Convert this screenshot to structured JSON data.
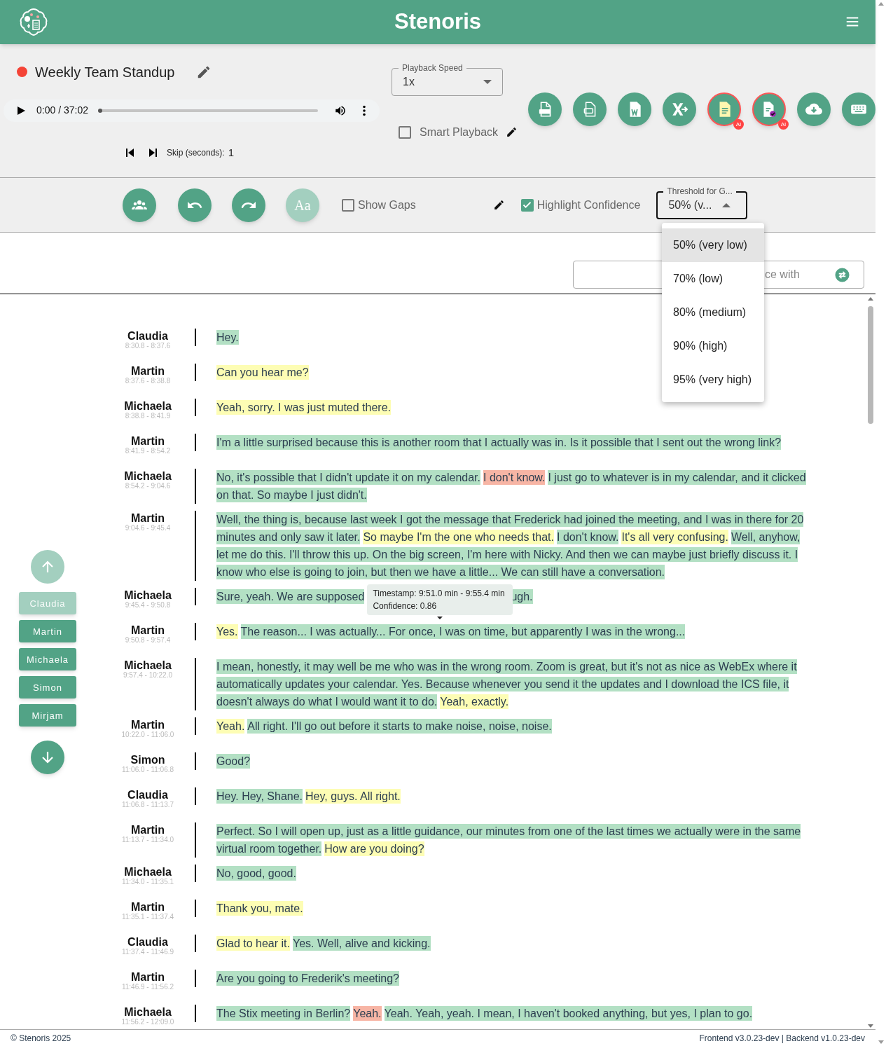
{
  "header": {
    "title": "Stenoris"
  },
  "recording": {
    "title": "Weekly Team Standup",
    "recording_dot": true
  },
  "player": {
    "time": "0:00 / 37:02",
    "level": 0.0
  },
  "skip": {
    "label": "Skip (seconds):",
    "value": "1"
  },
  "playback_speed": {
    "label": "Playback Speed",
    "value": "1x"
  },
  "smart_playback": {
    "label": "Smart Playback",
    "checked": false
  },
  "export_buttons": [
    {
      "kind": "txt",
      "ai": false
    },
    {
      "kind": "srt",
      "ai": false
    },
    {
      "kind": "word",
      "ai": false
    },
    {
      "kind": "excel",
      "ai": false
    },
    {
      "kind": "summary",
      "ai": true,
      "badge": "AI"
    },
    {
      "kind": "review",
      "ai": true,
      "badge": "AI"
    },
    {
      "kind": "cloud",
      "ai": false
    },
    {
      "kind": "keyboard",
      "ai": false
    }
  ],
  "toolbar": {
    "buttons": [
      {
        "kind": "speakers",
        "disabled": false
      },
      {
        "kind": "undo",
        "disabled": false
      },
      {
        "kind": "redo",
        "disabled": false
      },
      {
        "kind": "font",
        "disabled": true,
        "label": "Aa"
      }
    ],
    "show_gaps": {
      "label": "Show Gaps",
      "checked": false
    },
    "highlight_confidence": {
      "label": "Highlight Confidence",
      "checked": true
    },
    "threshold": {
      "label": "Threshold for G...",
      "value": "50% (v...",
      "expanded": true,
      "options": [
        {
          "label": "50% (very low)",
          "selected": true
        },
        {
          "label": "70% (low)",
          "selected": false
        },
        {
          "label": "80% (medium)",
          "selected": false
        },
        {
          "label": "90% (high)",
          "selected": false
        },
        {
          "label": "95% (very high)",
          "selected": false
        }
      ]
    }
  },
  "replace_field": {
    "placeholder": "ce with"
  },
  "speaker_nav": [
    {
      "label": "Claudia",
      "disabled": true
    },
    {
      "label": "Martin",
      "disabled": false
    },
    {
      "label": "Michaela",
      "disabled": false
    },
    {
      "label": "Simon",
      "disabled": false
    },
    {
      "label": "Mirjam",
      "disabled": false
    }
  ],
  "transcript": [
    {
      "speaker": "Claudia",
      "time": "8:30.8 - 8:37.6",
      "lines": [
        [
          {
            "text": "Hey.",
            "color": "#b3e0c4"
          }
        ]
      ]
    },
    {
      "speaker": "Martin",
      "time": "8:37.6 - 8:38.8",
      "lines": [
        [
          {
            "text": "Can you hear me?",
            "color": "#fdfdb4"
          }
        ]
      ]
    },
    {
      "speaker": "Michaela",
      "time": "8:38.8 - 8:41.9",
      "lines": [
        [
          {
            "text": "Yeah, sorry. I was just muted there.",
            "color": "#fdfdb4"
          }
        ]
      ]
    },
    {
      "speaker": "Martin",
      "time": "8:41.9 - 8:54.2",
      "lines": [
        [
          {
            "text": "I'm a little surprised because this is another room that I actually was in. Is it possible that I sent out the wrong link?",
            "color": "#b3e0c4"
          }
        ]
      ]
    },
    {
      "speaker": "Michaela",
      "time": "8:54.2 - 9:04.6",
      "lines": [
        [
          {
            "text": "No, it's possible that I didn't update it on my calendar.",
            "color": "#b3e0c4"
          },
          {
            "text": "I don't know.",
            "color": "#f7b5a5"
          },
          {
            "text": "I just go to whatever is in my calendar, and it clicked",
            "color": "#b3e0c4"
          }
        ],
        [
          {
            "text": "on that. So maybe I just didn't.",
            "color": "#b3e0c4"
          }
        ]
      ]
    },
    {
      "speaker": "Martin",
      "time": "9:04.6 - 9:45.4",
      "lines": [
        [
          {
            "text": "Well, the thing is, because last week I got the message that Frederick had joined the meeting, and I was in there for 20",
            "color": "#b3e0c4"
          }
        ],
        [
          {
            "text": "minutes and only saw it later.",
            "color": "#b3e0c4"
          },
          {
            "text": "So maybe I'm the one who needs that.",
            "color": "#fdfdb4"
          },
          {
            "text": "I don't know.",
            "color": "#b3e0c4"
          },
          {
            "text": "It's all very confusing.",
            "color": "#fdfdb4"
          },
          {
            "text": "Well, anyhow,",
            "color": "#b3e0c4"
          }
        ],
        [
          {
            "text": "let me do this. I'll throw this up. On the big screen, I'm here with Nicky. And then we can maybe just briefly discuss it. I",
            "color": "#b3e0c4"
          }
        ],
        [
          {
            "text": "know who else is going to join, but then we have a little... We can still have a conversation.",
            "color": "#b3e0c4"
          }
        ]
      ]
    },
    {
      "speaker": "Michaela",
      "time": "9:45.4 - 9:50.8",
      "lines": [
        [
          {
            "text": "Sure, yeah. We are supposed",
            "color": "#b3e0c4"
          },
          {
            "kind": "tooltip",
            "lines": [
              "Timestamp: 9:51.0 min - 9:55.4 min",
              "Confidence: 0.86"
            ]
          },
          {
            "text": "ugh.",
            "color": "#b3e0c4"
          }
        ]
      ]
    },
    {
      "speaker": "Martin",
      "time": "9:50.8 - 9:57.4",
      "lines": [
        [
          {
            "text": "Yes.",
            "color": "#fdfdb4"
          },
          {
            "text": "The reason... I was actually... For once, I was on time, but apparently I was in the wrong...",
            "color": "#b3e0c4"
          }
        ]
      ]
    },
    {
      "speaker": "Michaela",
      "time": "9:57.4 - 10:22.0",
      "lines": [
        [
          {
            "text": "I mean, honestly, it may well be me who was in the wrong room. Zoom is great, but it's not as nice as WebEx where it",
            "color": "#b3e0c4"
          }
        ],
        [
          {
            "text": "automatically updates your calendar. Yes. Because whenever you send it the updates and I download the ICS file, it",
            "color": "#b3e0c4"
          }
        ],
        [
          {
            "text": "doesn't always do what I would want it to do.",
            "color": "#b3e0c4"
          },
          {
            "text": "Yeah, exactly.",
            "color": "#fdfdb4"
          }
        ]
      ]
    },
    {
      "speaker": "Martin",
      "time": "10:22.0 - 11:06.0",
      "lines": [
        [
          {
            "text": "Yeah.",
            "color": "#fdfdb4"
          },
          {
            "text": "All right. I'll go out before it starts to make noise, noise, noise.",
            "color": "#b3e0c4"
          }
        ]
      ]
    },
    {
      "speaker": "Simon",
      "time": "11:06.0 - 11:06.8",
      "lines": [
        [
          {
            "text": "Good?",
            "color": "#b3e0c4"
          }
        ]
      ]
    },
    {
      "speaker": "Claudia",
      "time": "11:06.8 - 11:13.7",
      "lines": [
        [
          {
            "text": "Hey. Hey, Shane.",
            "color": "#b3e0c4"
          },
          {
            "text": "Hey, guys. All right.",
            "color": "#fdfdb4"
          }
        ]
      ]
    },
    {
      "speaker": "Martin",
      "time": "11:13.7 - 11:34.0",
      "lines": [
        [
          {
            "text": "Perfect. So I will open up, just as a little guidance, our minutes from one of the last times we actually were in the same",
            "color": "#b3e0c4"
          }
        ],
        [
          {
            "text": "virtual room together.",
            "color": "#b3e0c4"
          },
          {
            "text": "How are you doing?",
            "color": "#fdfdb4"
          }
        ]
      ]
    },
    {
      "speaker": "Michaela",
      "time": "11:34.0 - 11:35.1",
      "lines": [
        [
          {
            "text": "No, good, good.",
            "color": "#b3e0c4"
          }
        ]
      ]
    },
    {
      "speaker": "Martin",
      "time": "11:35.1 - 11:37.4",
      "lines": [
        [
          {
            "text": "Thank you, mate.",
            "color": "#fdfdb4"
          }
        ]
      ]
    },
    {
      "speaker": "Claudia",
      "time": "11:37.4 - 11:46.9",
      "lines": [
        [
          {
            "text": "Glad to hear it.",
            "color": "#fdfdb4"
          },
          {
            "text": "Yes. Well, alive and kicking.",
            "color": "#b3e0c4"
          }
        ]
      ]
    },
    {
      "speaker": "Martin",
      "time": "11:46.9 - 11:56.2",
      "lines": [
        [
          {
            "text": "Are you going to Frederik's meeting?",
            "color": "#b3e0c4"
          }
        ]
      ]
    },
    {
      "speaker": "Michaela",
      "time": "11:56.2 - 12:09.0",
      "lines": [
        [
          {
            "text": "The Stix meeting in Berlin?",
            "color": "#b3e0c4"
          },
          {
            "text": "Yeah.",
            "color": "#f7b5a5"
          },
          {
            "text": "Yeah. Yeah, yeah. I mean, I haven't booked anything, but yes, I plan to go.",
            "color": "#b3e0c4"
          }
        ]
      ]
    }
  ],
  "footer": {
    "copyright": "© Stenoris 2025",
    "versions": "Frontend v3.0.23-dev | Backend v1.0.23-dev"
  }
}
